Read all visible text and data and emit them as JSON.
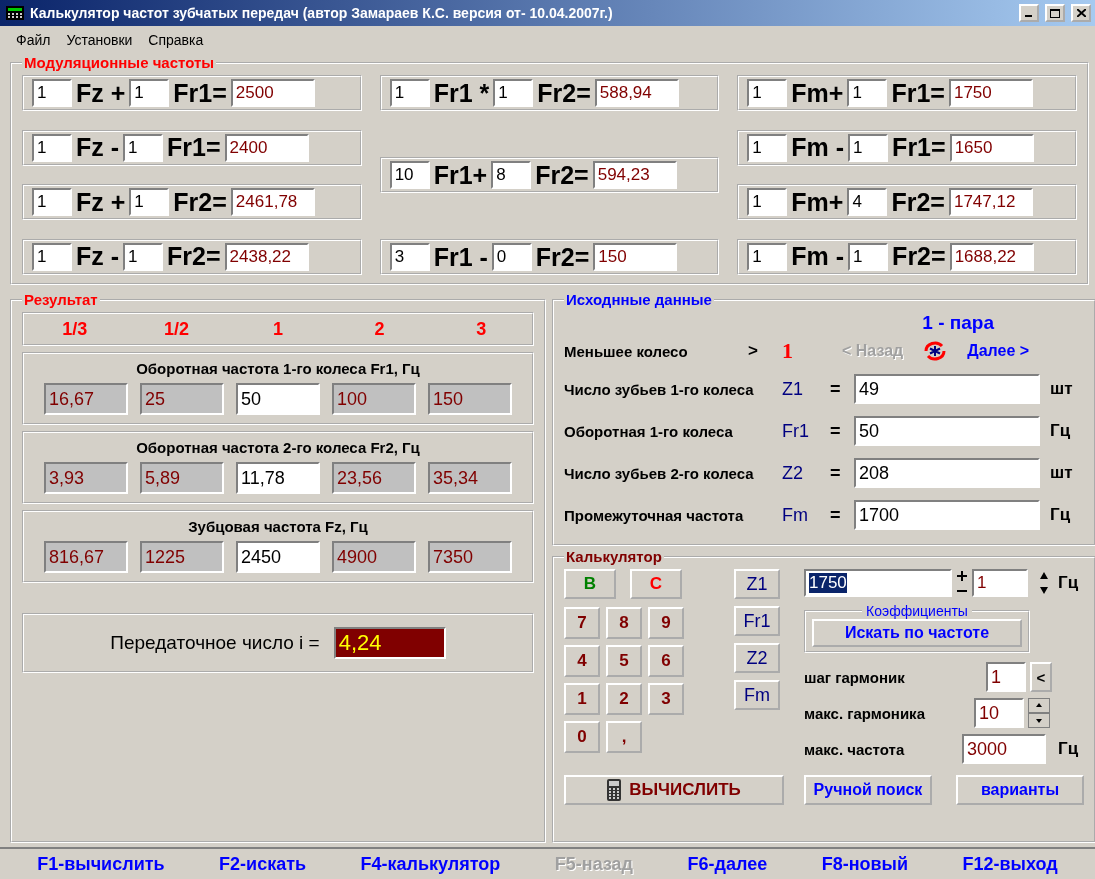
{
  "window": {
    "title": "Калькулятор частот зубчатых передач  (автор Замараев К.С. версия от- 10.04.2007г.)"
  },
  "menu": [
    "Файл",
    "Установки",
    "Справка"
  ],
  "modulation": {
    "title": "Модуляционные частоты",
    "columns": [
      [
        {
          "a": "1",
          "left": "Fz +",
          "b": "1",
          "right": "Fr1=",
          "result": "2500"
        },
        {
          "a": "1",
          "left": "Fz -",
          "b": "1",
          "right": "Fr1=",
          "result": "2400"
        },
        {
          "a": "1",
          "left": "Fz +",
          "b": "1",
          "right": "Fr2=",
          "result": "2461,78"
        },
        {
          "a": "1",
          "left": "Fz -",
          "b": "1",
          "right": "Fr2=",
          "result": "2438,22"
        }
      ],
      [
        {
          "a": "1",
          "left": "Fr1 *",
          "b": "1",
          "right": "Fr2=",
          "result": "588,94"
        },
        {
          "a": "10",
          "left": "Fr1+",
          "b": "8",
          "right": "Fr2=",
          "result": "594,23"
        },
        {
          "a": "3",
          "left": "Fr1 -",
          "b": "0",
          "right": "Fr2=",
          "result": "150"
        }
      ],
      [
        {
          "a": "1",
          "left": "Fm+",
          "b": "1",
          "right": "Fr1=",
          "result": "1750"
        },
        {
          "a": "1",
          "left": "Fm -",
          "b": "1",
          "right": "Fr1=",
          "result": "1650"
        },
        {
          "a": "1",
          "left": "Fm+",
          "b": "4",
          "right": "Fr2=",
          "result": "1747,12"
        },
        {
          "a": "1",
          "left": "Fm -",
          "b": "1",
          "right": "Fr2=",
          "result": "1688,22"
        }
      ]
    ]
  },
  "result": {
    "title": "Результат",
    "multipliers": [
      "1/3",
      "1/2",
      "1",
      "2",
      "3"
    ],
    "groups": [
      {
        "title": "Оборотная частота 1-го колеса Fr1, Гц",
        "values": [
          {
            "value": "16,67",
            "editable": false
          },
          {
            "value": "25",
            "editable": false
          },
          {
            "value": "50",
            "editable": true
          },
          {
            "value": "100",
            "editable": false
          },
          {
            "value": "150",
            "editable": false
          }
        ]
      },
      {
        "title": "Оборотная частота 2-го колеса Fr2, Гц",
        "values": [
          {
            "value": "3,93",
            "editable": false
          },
          {
            "value": "5,89",
            "editable": false
          },
          {
            "value": "11,78",
            "editable": true
          },
          {
            "value": "23,56",
            "editable": false
          },
          {
            "value": "35,34",
            "editable": false
          }
        ]
      },
      {
        "title": "Зубцовая частота  Fz, Гц",
        "values": [
          {
            "value": "816,67",
            "editable": false
          },
          {
            "value": "1225",
            "editable": false
          },
          {
            "value": "2450",
            "editable": true
          },
          {
            "value": "4900",
            "editable": false
          },
          {
            "value": "7350",
            "editable": false
          }
        ]
      }
    ],
    "ratio": {
      "label": "Передаточное число i =",
      "value": "4,24"
    }
  },
  "source": {
    "title": "Исходнные данные",
    "pair": "1 - пара",
    "smaller_label": "Меньшее колесо",
    "smaller_arrow": ">",
    "smaller_value": "1",
    "back": {
      "label": "< Назад",
      "disabled": true
    },
    "next": {
      "label": "Далее >",
      "disabled": false
    },
    "fields": [
      {
        "label": "Число зубьев 1-го колеса",
        "symbol": "Z1",
        "eq": "=",
        "value": "49",
        "unit": "шт"
      },
      {
        "label": "Оборотная  1-го колеса",
        "symbol": "Fr1",
        "eq": "=",
        "value": "50",
        "unit": "Гц"
      },
      {
        "label": "Число зубьев 2-го колеса",
        "symbol": "Z2",
        "eq": "=",
        "value": "208",
        "unit": "шт"
      },
      {
        "label": "Промежуточная частота",
        "symbol": "Fm",
        "eq": "=",
        "value": "1700",
        "unit": "Гц"
      }
    ]
  },
  "calculator": {
    "title": "Калькулятор",
    "b": "B",
    "c": "C",
    "digits": [
      "7",
      "8",
      "9",
      "4",
      "5",
      "6",
      "1",
      "2",
      "3",
      "0",
      ","
    ],
    "variables": [
      "Z1",
      "Fr1",
      "Z2",
      "Fm"
    ],
    "display": "1750",
    "step": "1",
    "step_unit": "Гц",
    "coefficients": {
      "title": "Коэффициенты",
      "button": "Искать по частоте"
    },
    "harmonic_step": {
      "label": "шаг гармоник",
      "value": "1",
      "button": "<"
    },
    "max_harmonic": {
      "label": "макс. гармоника",
      "value": "10"
    },
    "max_freq": {
      "label": "макс. частота",
      "value": "3000",
      "unit": "Гц"
    },
    "compute": "ВЫЧИСЛИТЬ",
    "manual": "Ручной поиск",
    "variants": "варианты"
  },
  "status_bar": [
    {
      "label": "F1-вычислить",
      "disabled": false
    },
    {
      "label": "F2-искать",
      "disabled": false
    },
    {
      "label": "F4-калькулятор",
      "disabled": false
    },
    {
      "label": "F5-назад",
      "disabled": true
    },
    {
      "label": "F6-далее",
      "disabled": false
    },
    {
      "label": "F8-новый",
      "disabled": false
    },
    {
      "label": "F12-выход",
      "disabled": false
    }
  ]
}
